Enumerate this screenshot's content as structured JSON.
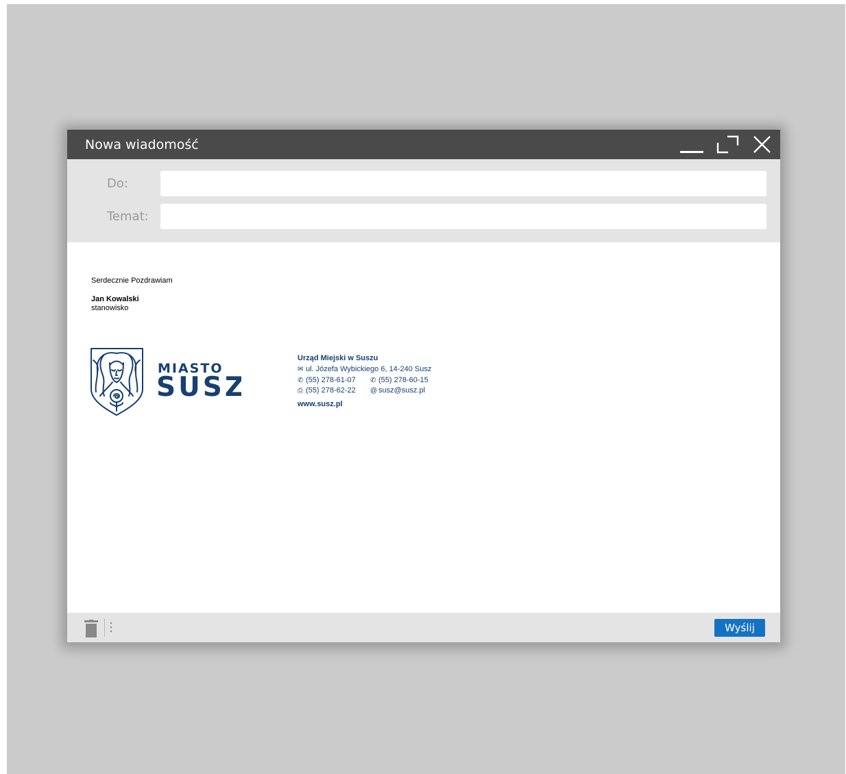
{
  "window": {
    "title": "Nowa wiadomość"
  },
  "header_fields": {
    "to_label": "Do:",
    "to_value": "",
    "subject_label": "Temat:",
    "subject_value": ""
  },
  "body": {
    "greeting": "Serdecznie Pozdrawiam",
    "signature_name": "Jan Kowalski",
    "signature_role": "stanowisko",
    "logo": {
      "line1": "MIASTO",
      "line2": "SUSZ",
      "icon": "crest-woman-rose-icon",
      "color": "#173f73"
    },
    "office": {
      "name": "Urząd Miejski w Suszu",
      "address": "ul. Józefa Wybickiego 6, 14-240 Susz",
      "phone1": "(55) 278-61-07",
      "phone2": "(55) 278-60-15",
      "fax": "(55) 278-62-22",
      "email": "susz@susz.pl",
      "website": "www.susz.pl",
      "icons": {
        "address": "envelope-icon",
        "phone1": "phone-icon",
        "phone2": "phone-icon",
        "fax": "printer-icon",
        "email": "at-icon"
      }
    }
  },
  "footer": {
    "send_label": "Wyślij",
    "send_color": "#1572c3"
  },
  "colors": {
    "titlebar": "#4a4a4a",
    "panel": "#e4e4e4",
    "backdrop": "#cbcbcb"
  }
}
